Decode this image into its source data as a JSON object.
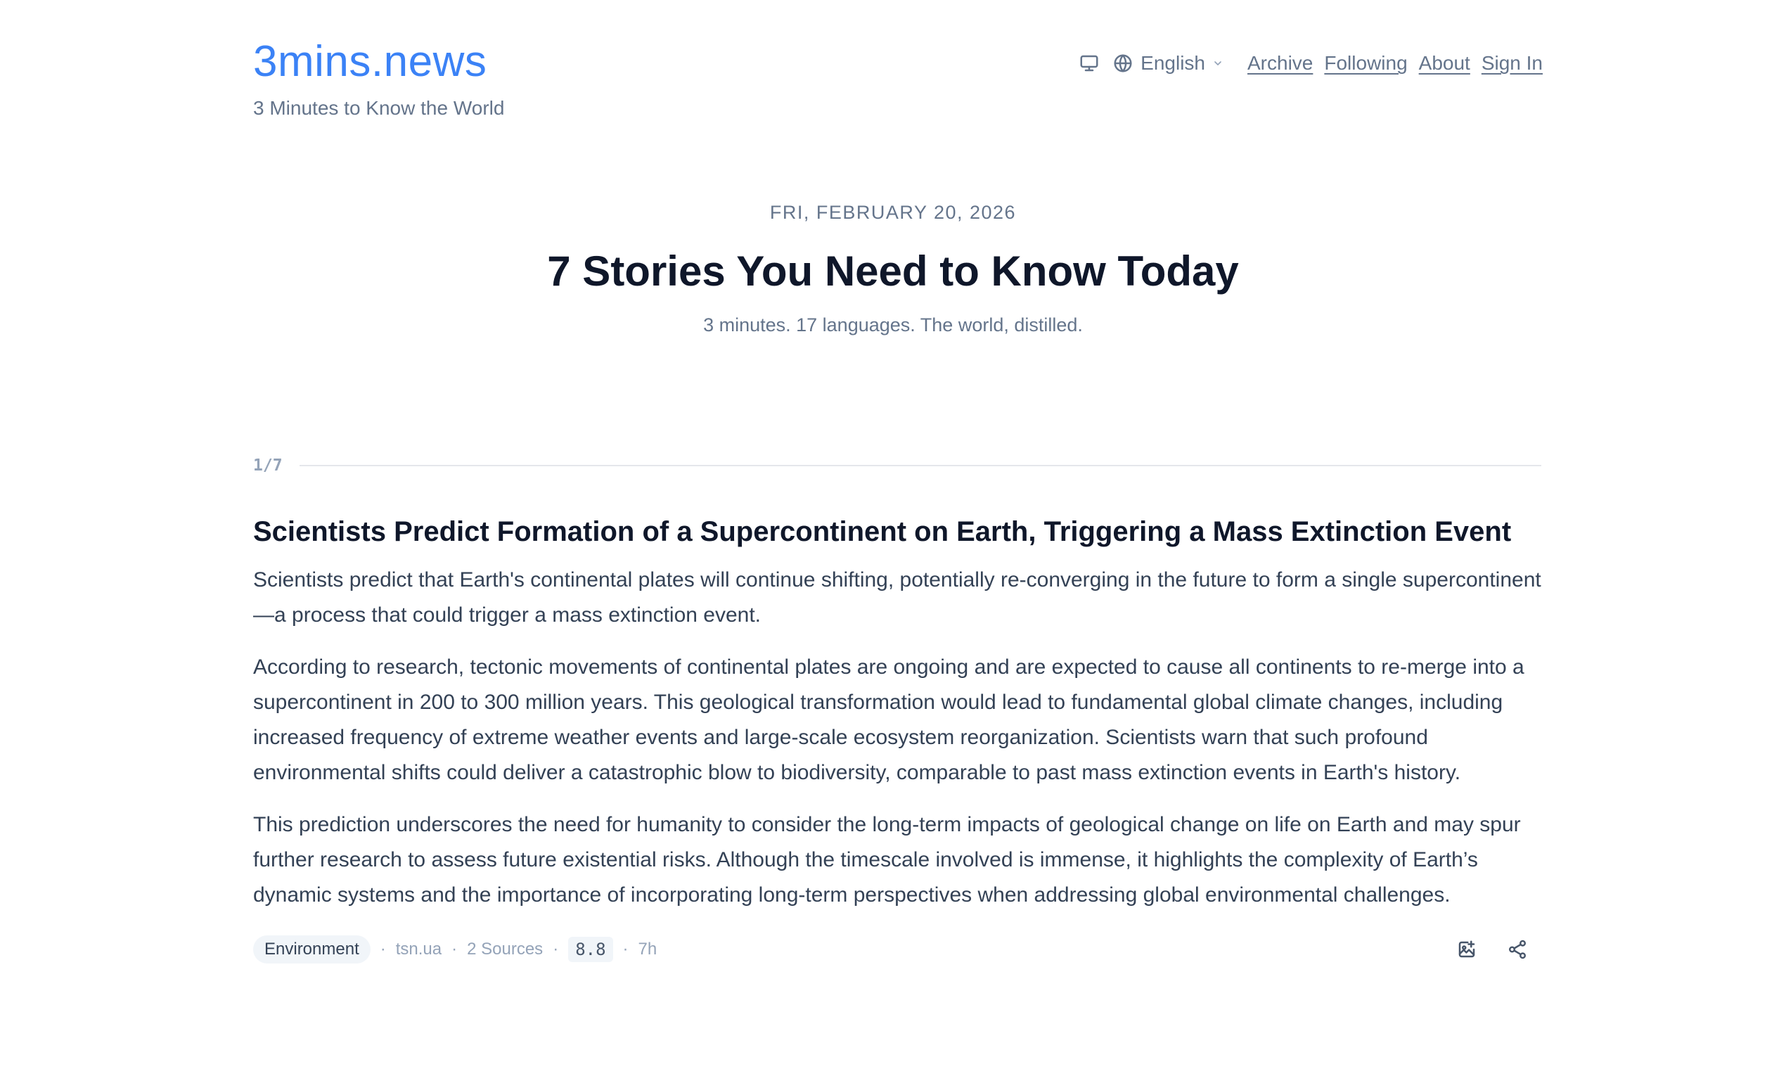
{
  "brand": {
    "name": "3mins.news",
    "tagline": "3 Minutes to Know the World"
  },
  "nav": {
    "display_icon": "monitor-icon",
    "language_icon": "globe-icon",
    "language": "English",
    "links": [
      "Archive",
      "Following",
      "About",
      "Sign In"
    ]
  },
  "hero": {
    "date": "FRI, FEBRUARY 20, 2026",
    "title": "7 Stories You Need to Know Today",
    "subtitle": "3 minutes. 17 languages. The world, distilled."
  },
  "story": {
    "index": "1/7",
    "title": "Scientists Predict Formation of a Supercontinent on Earth, Triggering a Mass Extinction Event",
    "paragraphs": [
      "Scientists predict that Earth's continental plates will continue shifting, potentially re-converging in the future to form a single supercontinent—a process that could trigger a mass extinction event.",
      "According to research, tectonic movements of continental plates are ongoing and are expected to cause all continents to re-merge into a supercontinent in 200 to 300 million years. This geological transformation would lead to fundamental global climate changes, including increased frequency of extreme weather events and large-scale ecosystem reorganization. Scientists warn that such profound environmental shifts could deliver a catastrophic blow to biodiversity, comparable to past mass extinction events in Earth's history.",
      "This prediction underscores the need for humanity to consider the long-term impacts of geological change on life on Earth and may spur further research to assess future existential risks. Although the timescale involved is immense, it highlights the complexity of Earth’s dynamic systems and the importance of incorporating long-term perspectives when addressing global environmental challenges."
    ],
    "meta": {
      "category": "Environment",
      "source": "tsn.ua",
      "sources_count": "2 Sources",
      "score": "8.8",
      "age": "7h"
    },
    "actions": {
      "image_icon": "image-card-icon",
      "share_icon": "share-icon"
    }
  },
  "colors": {
    "brand": "#3b82f6",
    "heading": "#0f172a",
    "body": "#334155",
    "muted": "#64748b",
    "faint": "#94a3b8",
    "chip": "#f1f5f9",
    "rule": "#e5e7eb"
  }
}
